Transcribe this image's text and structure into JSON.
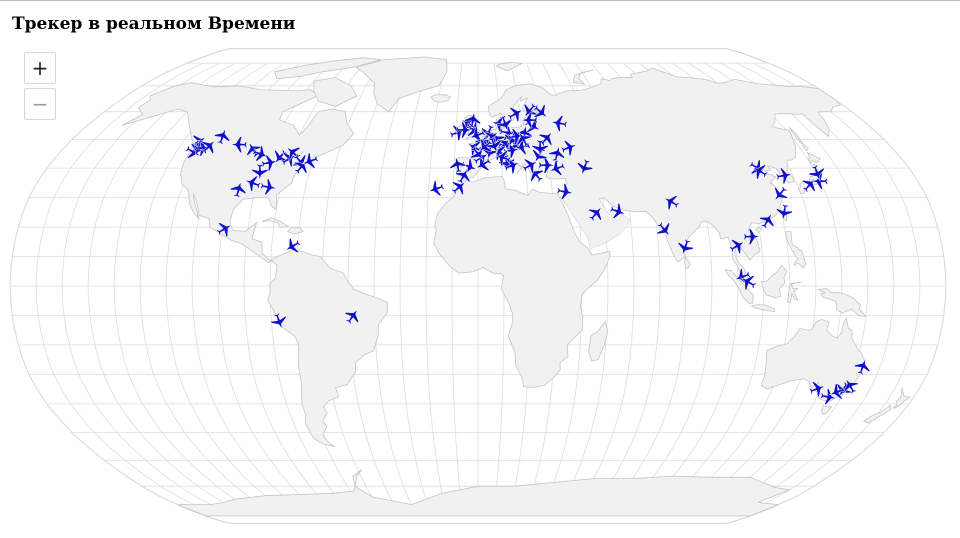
{
  "page": {
    "title": "Трекер в реальном Времени"
  },
  "zoom": {
    "in_label": "+",
    "out_label": "−"
  },
  "colors": {
    "aircraft": "#1010c8",
    "land": "#f1f1f1",
    "land_border": "#c4c4c4",
    "graticule": "#dddddd",
    "ocean": "#ffffff"
  },
  "map": {
    "projection": "robinson",
    "icon": "airplane-icon",
    "aircraft": [
      {
        "lon": -123.1,
        "lat": 49.3,
        "hdg": 60
      },
      {
        "lon": -122.3,
        "lat": 47.5,
        "hdg": 300
      },
      {
        "lon": -122.6,
        "lat": 45.6,
        "hdg": 120
      },
      {
        "lon": -121.5,
        "lat": 46.8,
        "hdg": 200
      },
      {
        "lon": -119.8,
        "lat": 47.0,
        "hdg": 90
      },
      {
        "lon": -117.4,
        "lat": 47.6,
        "hdg": 45
      },
      {
        "lon": -114.1,
        "lat": 51.1,
        "hdg": 20
      },
      {
        "lon": -104.7,
        "lat": 48.2,
        "hdg": 270
      },
      {
        "lon": -97.5,
        "lat": 46.5,
        "hdg": 330
      },
      {
        "lon": -93.2,
        "lat": 44.9,
        "hdg": 110
      },
      {
        "lon": -87.9,
        "lat": 41.9,
        "hdg": 80
      },
      {
        "lon": -84.4,
        "lat": 43.8,
        "hdg": 220
      },
      {
        "lon": -80.2,
        "lat": 43.2,
        "hdg": 60
      },
      {
        "lon": -79.6,
        "lat": 45.4,
        "hdg": 310
      },
      {
        "lon": -75.0,
        "lat": 42.2,
        "hdg": 140
      },
      {
        "lon": -73.8,
        "lat": 40.6,
        "hdg": 40
      },
      {
        "lon": -71.0,
        "lat": 42.4,
        "hdg": 250
      },
      {
        "lon": -90.5,
        "lat": 38.7,
        "hdg": 180
      },
      {
        "lon": -96.9,
        "lat": 32.9,
        "hdg": 15
      },
      {
        "lon": -92.0,
        "lat": 35.0,
        "hdg": 290
      },
      {
        "lon": -85.0,
        "lat": 33.6,
        "hdg": 100
      },
      {
        "lon": -99.1,
        "lat": 19.4,
        "hdg": 60
      },
      {
        "lon": -72.0,
        "lat": 13.5,
        "hdg": 240
      },
      {
        "lon": -48.4,
        "lat": -10.2,
        "hdg": 35
      },
      {
        "lon": -77.0,
        "lat": -12.0,
        "hdg": 160
      },
      {
        "lon": -9.1,
        "lat": 52.5,
        "hdg": 70
      },
      {
        "lon": -4.5,
        "lat": 55.6,
        "hdg": 300
      },
      {
        "lon": -2.0,
        "lat": 53.4,
        "hdg": 120
      },
      {
        "lon": -0.4,
        "lat": 51.5,
        "hdg": 250
      },
      {
        "lon": 2.4,
        "lat": 49.0,
        "hdg": 20
      },
      {
        "lon": 4.8,
        "lat": 52.3,
        "hdg": 200
      },
      {
        "lon": 8.6,
        "lat": 50.0,
        "hdg": 330
      },
      {
        "lon": 11.8,
        "lat": 48.4,
        "hdg": 45
      },
      {
        "lon": 13.4,
        "lat": 52.4,
        "hdg": 100
      },
      {
        "lon": 10.0,
        "lat": 55.6,
        "hdg": 280
      },
      {
        "lon": 12.6,
        "lat": 55.6,
        "hdg": 160
      },
      {
        "lon": 18.1,
        "lat": 59.3,
        "hdg": 60
      },
      {
        "lon": 24.9,
        "lat": 60.3,
        "hdg": 220
      },
      {
        "lon": 21.0,
        "lat": 52.2,
        "hdg": 10
      },
      {
        "lon": 16.4,
        "lat": 48.1,
        "hdg": 140
      },
      {
        "lon": 19.3,
        "lat": 47.4,
        "hdg": 260
      },
      {
        "lon": 14.5,
        "lat": 46.2,
        "hdg": 80
      },
      {
        "lon": 9.2,
        "lat": 45.6,
        "hdg": 300
      },
      {
        "lon": 5.0,
        "lat": 45.7,
        "hdg": 190
      },
      {
        "lon": 1.4,
        "lat": 43.6,
        "hdg": 60
      },
      {
        "lon": -3.7,
        "lat": 40.5,
        "hdg": 110
      },
      {
        "lon": -8.6,
        "lat": 41.2,
        "hdg": 350
      },
      {
        "lon": -5.9,
        "lat": 37.4,
        "hdg": 30
      },
      {
        "lon": 2.1,
        "lat": 41.3,
        "hdg": 240
      },
      {
        "lon": 12.2,
        "lat": 41.8,
        "hdg": 170
      },
      {
        "lon": 14.3,
        "lat": 40.9,
        "hdg": 70
      },
      {
        "lon": 23.9,
        "lat": 37.9,
        "hdg": 320
      },
      {
        "lon": 28.8,
        "lat": 41.0,
        "hdg": 90
      },
      {
        "lon": 26.1,
        "lat": 44.4,
        "hdg": 210
      },
      {
        "lon": 30.5,
        "lat": 50.4,
        "hdg": 40
      },
      {
        "lon": 37.6,
        "lat": 55.8,
        "hdg": 280
      },
      {
        "lon": 30.3,
        "lat": 59.8,
        "hdg": 130
      },
      {
        "lon": 34.0,
        "lat": 45.0,
        "hdg": 15
      },
      {
        "lon": 32.9,
        "lat": 39.9,
        "hdg": 250
      },
      {
        "lon": 35.2,
        "lat": 32.0,
        "hdg": 100
      },
      {
        "lon": -1.5,
        "lat": 47.2,
        "hdg": 300
      },
      {
        "lon": 6.1,
        "lat": 50.8,
        "hdg": 50
      },
      {
        "lon": 7.1,
        "lat": 48.0,
        "hdg": 160
      },
      {
        "lon": 15.0,
        "lat": 50.0,
        "hdg": 200
      },
      {
        "lon": 17.0,
        "lat": 51.1,
        "hdg": 80
      },
      {
        "lon": 20.0,
        "lat": 50.1,
        "hdg": 330
      },
      {
        "lon": 25.3,
        "lat": 54.7,
        "hdg": 120
      },
      {
        "lon": 24.1,
        "lat": 56.9,
        "hdg": 270
      },
      {
        "lon": -6.3,
        "lat": 53.4,
        "hdg": 90
      },
      {
        "lon": -2.4,
        "lat": 57.0,
        "hdg": 10
      },
      {
        "lon": 0.0,
        "lat": 45.0,
        "hdg": 140
      },
      {
        "lon": 3.0,
        "lat": 47.5,
        "hdg": 230
      },
      {
        "lon": 10.5,
        "lat": 43.7,
        "hdg": 290
      },
      {
        "lon": 22.0,
        "lat": 41.0,
        "hdg": 60
      },
      {
        "lon": 27.0,
        "lat": 47.0,
        "hdg": 180
      },
      {
        "lon": 39.7,
        "lat": 47.2,
        "hdg": 70
      },
      {
        "lon": -17.0,
        "lat": 33.0,
        "hdg": 250
      },
      {
        "lon": -7.6,
        "lat": 33.6,
        "hdg": 50
      },
      {
        "lon": 44.5,
        "lat": 40.2,
        "hdg": 200
      },
      {
        "lon": 46.7,
        "lat": 24.7,
        "hdg": 40
      },
      {
        "lon": 55.4,
        "lat": 25.3,
        "hdg": 110
      },
      {
        "lon": 77.1,
        "lat": 28.6,
        "hdg": 300
      },
      {
        "lon": 72.9,
        "lat": 19.1,
        "hdg": 140
      },
      {
        "lon": 80.3,
        "lat": 13.1,
        "hdg": 200
      },
      {
        "lon": 100.7,
        "lat": 13.7,
        "hdg": 60
      },
      {
        "lon": 101.7,
        "lat": 3.1,
        "hdg": 250
      },
      {
        "lon": 103.9,
        "lat": 1.4,
        "hdg": 300
      },
      {
        "lon": 106.7,
        "lat": 16.8,
        "hdg": 90
      },
      {
        "lon": 113.9,
        "lat": 22.3,
        "hdg": 30
      },
      {
        "lon": 116.6,
        "lat": 40.1,
        "hdg": 120
      },
      {
        "lon": 121.5,
        "lat": 31.2,
        "hdg": 220
      },
      {
        "lon": 126.4,
        "lat": 37.5,
        "hdg": 80
      },
      {
        "lon": 135.2,
        "lat": 34.5,
        "hdg": 40
      },
      {
        "lon": 139.8,
        "lat": 35.6,
        "hdg": 270
      },
      {
        "lon": 140.5,
        "lat": 38.3,
        "hdg": 160
      },
      {
        "lon": 117.0,
        "lat": 39.0,
        "hdg": 300
      },
      {
        "lon": 121.0,
        "lat": 25.0,
        "hdg": 190
      },
      {
        "lon": 153.1,
        "lat": -27.4,
        "hdg": 20
      },
      {
        "lon": 144.8,
        "lat": -37.7,
        "hdg": 100
      },
      {
        "lon": 149.2,
        "lat": -35.3,
        "hdg": 210
      },
      {
        "lon": 151.2,
        "lat": -33.9,
        "hdg": 330
      },
      {
        "lon": 138.5,
        "lat": -34.9,
        "hdg": 70
      },
      {
        "lon": 147.2,
        "lat": -36.0,
        "hdg": 250
      }
    ]
  }
}
